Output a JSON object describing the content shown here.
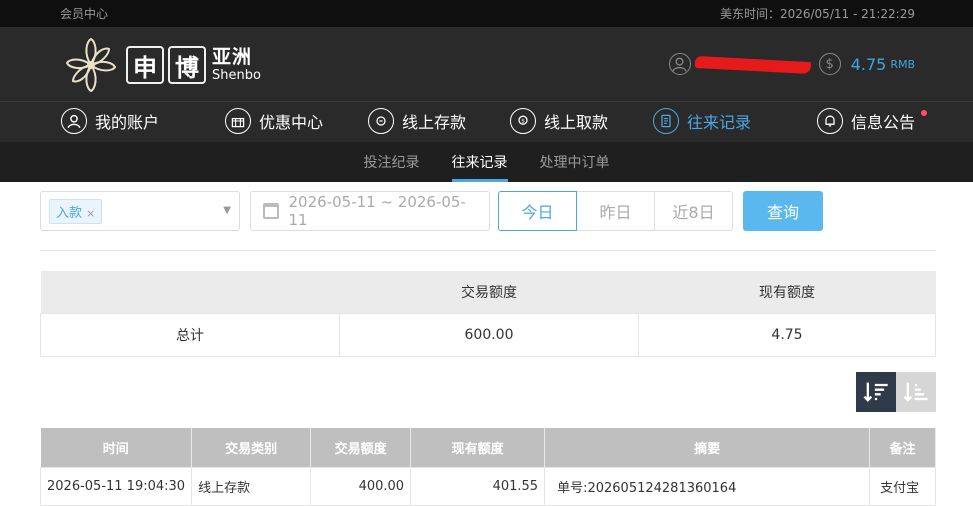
{
  "topbar": {
    "member_center": "会员中心",
    "time_label": "美东时间：2026/05/11 - 21:22:29"
  },
  "brand": {
    "logo_char1": "申",
    "logo_char2": "博",
    "logo_cn": "亚洲",
    "logo_en": "Shenbo"
  },
  "account": {
    "balance": "4.75",
    "currency": "RMB"
  },
  "mainnav": {
    "items": [
      {
        "label": "我的账户",
        "icon": "user-icon"
      },
      {
        "label": "优惠中心",
        "icon": "gift-icon"
      },
      {
        "label": "线上存款",
        "icon": "deposit-icon"
      },
      {
        "label": "线上取款",
        "icon": "withdraw-icon"
      },
      {
        "label": "往来记录",
        "icon": "records-icon"
      },
      {
        "label": "信息公告",
        "icon": "bell-icon"
      }
    ]
  },
  "subnav": {
    "items": [
      "投注纪录",
      "往来记录",
      "处理中订单"
    ]
  },
  "filters": {
    "type_tag": "入款",
    "date_range": "2026-05-11 ~ 2026-05-11",
    "seg": [
      "今日",
      "昨日",
      "近8日"
    ],
    "query": "查询"
  },
  "summary": {
    "headers": [
      "",
      "交易额度",
      "现有额度"
    ],
    "row": [
      "总计",
      "600.00",
      "4.75"
    ]
  },
  "records": {
    "headers": [
      "时间",
      "交易类别",
      "交易额度",
      "现有额度",
      "摘要",
      "备注"
    ],
    "rows": [
      [
        "2026-05-11 19:04:30",
        "线上存款",
        "400.00",
        "401.55",
        "单号:202605124281360164",
        "支付宝"
      ]
    ]
  },
  "colors": {
    "accent": "#4aa7e3",
    "header_bg": "#2a2a2a",
    "query_button": "#5ab8ee"
  }
}
